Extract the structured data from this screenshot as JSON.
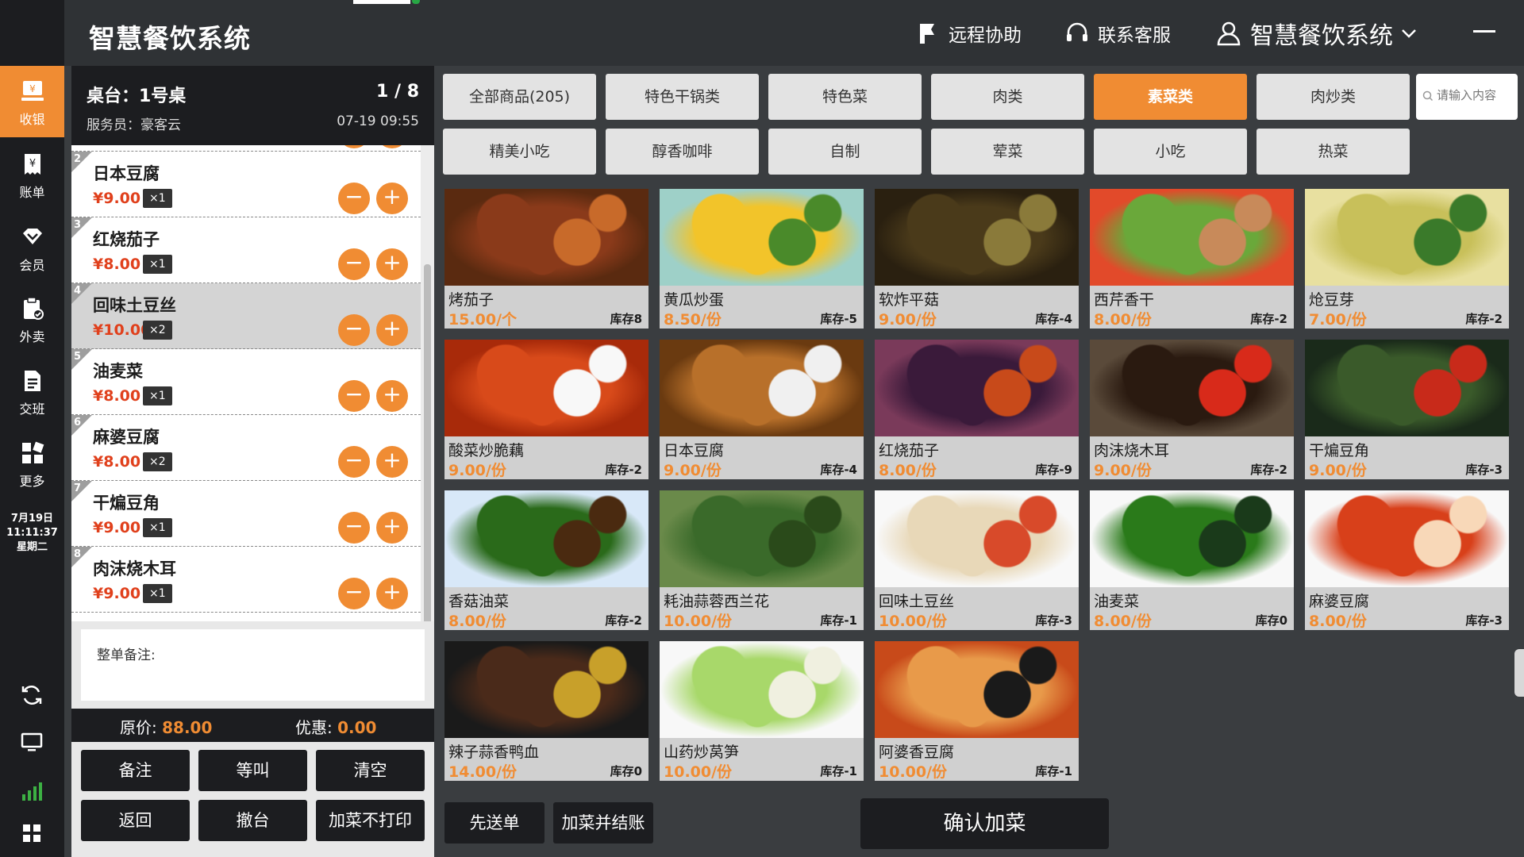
{
  "app_title": "智慧餐饮系统",
  "header": {
    "remote_assist": "远程协助",
    "contact_service": "联系客服",
    "user_menu": "智慧餐饮系统"
  },
  "nav": {
    "items": [
      {
        "label": "收银",
        "icon": "cashier-icon",
        "active": true
      },
      {
        "label": "账单",
        "icon": "bill-icon",
        "active": false
      },
      {
        "label": "会员",
        "icon": "member-icon",
        "active": false
      },
      {
        "label": "外卖",
        "icon": "takeout-icon",
        "active": false
      },
      {
        "label": "交班",
        "icon": "shift-icon",
        "active": false
      },
      {
        "label": "更多",
        "icon": "more-icon",
        "active": false
      }
    ],
    "clock": {
      "date": "7月19日",
      "time": "11:11:37",
      "weekday": "星期二"
    }
  },
  "order": {
    "table": "桌台：1号桌",
    "waiter": "服务员：豪客云",
    "page": "1 / 8",
    "time": "07-19 09:55",
    "items": [
      {
        "index": "2",
        "name": "日本豆腐",
        "price": "¥9.00",
        "qty": "×1",
        "selected": false
      },
      {
        "index": "3",
        "name": "红烧茄子",
        "price": "¥8.00",
        "qty": "×1",
        "selected": false
      },
      {
        "index": "4",
        "name": "回味土豆丝",
        "price": "¥10.00",
        "qty": "×2",
        "selected": true
      },
      {
        "index": "5",
        "name": "油麦菜",
        "price": "¥8.00",
        "qty": "×1",
        "selected": false
      },
      {
        "index": "6",
        "name": "麻婆豆腐",
        "price": "¥8.00",
        "qty": "×2",
        "selected": false
      },
      {
        "index": "7",
        "name": "干煸豆角",
        "price": "¥9.00",
        "qty": "×1",
        "selected": false
      },
      {
        "index": "8",
        "name": "肉沫烧木耳",
        "price": "¥9.00",
        "qty": "×1",
        "selected": false
      }
    ],
    "remark_label": "整单备注:",
    "original_price_label": "原价:",
    "original_price": "88.00",
    "discount_label": "优惠:",
    "discount": "0.00",
    "buttons": [
      "备注",
      "等叫",
      "清空",
      "返回",
      "撤台",
      "加菜不打印"
    ]
  },
  "categories": {
    "items": [
      {
        "label": "全部商品(205)",
        "active": false
      },
      {
        "label": "特色干锅类",
        "active": false
      },
      {
        "label": "特色菜",
        "active": false
      },
      {
        "label": "肉类",
        "active": false
      },
      {
        "label": "素菜类",
        "active": true
      },
      {
        "label": "肉炒类",
        "active": false
      },
      {
        "label": "精美小吃",
        "active": false
      },
      {
        "label": "醇香咖啡",
        "active": false
      },
      {
        "label": "自制",
        "active": false
      },
      {
        "label": "荤菜",
        "active": false
      },
      {
        "label": "小吃",
        "active": false
      },
      {
        "label": "热菜",
        "active": false
      }
    ],
    "search_placeholder": "请输入内容"
  },
  "dishes": [
    {
      "name": "烤茄子",
      "price": "15.00/个",
      "stock": "库存8",
      "colors": [
        "#8a3a1a",
        "#c86a2a",
        "#5a2a10"
      ]
    },
    {
      "name": "黄瓜炒蛋",
      "price": "8.50/份",
      "stock": "库存-5",
      "colors": [
        "#f2c42a",
        "#4a8a2a",
        "#9ed0c8"
      ]
    },
    {
      "name": "软炸平菇",
      "price": "9.00/份",
      "stock": "库存-4",
      "colors": [
        "#4a3a1a",
        "#8a7a3a",
        "#2a2010"
      ]
    },
    {
      "name": "西芹香干",
      "price": "8.00/份",
      "stock": "库存-2",
      "colors": [
        "#6aa83a",
        "#c88a5a",
        "#e24a2a"
      ]
    },
    {
      "name": "炝豆芽",
      "price": "7.00/份",
      "stock": "库存-2",
      "colors": [
        "#c8c05a",
        "#3a7a2a",
        "#e8e0a0"
      ]
    },
    {
      "name": "酸菜炒脆藕",
      "price": "9.00/份",
      "stock": "库存-2",
      "colors": [
        "#d84a1a",
        "#f8f8f8",
        "#a82a0a"
      ]
    },
    {
      "name": "日本豆腐",
      "price": "9.00/份",
      "stock": "库存-4",
      "colors": [
        "#b8702a",
        "#f0f0f0",
        "#6a3a10"
      ]
    },
    {
      "name": "红烧茄子",
      "price": "8.00/份",
      "stock": "库存-9",
      "colors": [
        "#3a1a3a",
        "#c84a1a",
        "#7a3a5a"
      ]
    },
    {
      "name": "肉沫烧木耳",
      "price": "9.00/份",
      "stock": "库存-2",
      "colors": [
        "#2a1a10",
        "#d82a1a",
        "#5a4a3a"
      ]
    },
    {
      "name": "干煸豆角",
      "price": "9.00/份",
      "stock": "库存-3",
      "colors": [
        "#3a5a2a",
        "#c82a1a",
        "#1a2a1a"
      ]
    },
    {
      "name": "香菇油菜",
      "price": "8.00/份",
      "stock": "库存-2",
      "colors": [
        "#2a6a1a",
        "#4a2a10",
        "#d8e8f8"
      ]
    },
    {
      "name": "耗油蒜蓉西兰花",
      "price": "10.00/份",
      "stock": "库存-1",
      "colors": [
        "#3a6a2a",
        "#2a4a1a",
        "#6a8a4a"
      ]
    },
    {
      "name": "回味土豆丝",
      "price": "10.00/份",
      "stock": "库存-3",
      "colors": [
        "#e8d8b8",
        "#d84a2a",
        "#f8f8f8"
      ]
    },
    {
      "name": "油麦菜",
      "price": "8.00/份",
      "stock": "库存0",
      "colors": [
        "#2a7a1a",
        "#1a3a1a",
        "#f8f8f8"
      ]
    },
    {
      "name": "麻婆豆腐",
      "price": "8.00/份",
      "stock": "库存-3",
      "colors": [
        "#d8401a",
        "#f8d8b8",
        "#f8f8f8"
      ]
    },
    {
      "name": "辣子蒜香鸭血",
      "price": "14.00/份",
      "stock": "库存0",
      "colors": [
        "#4a2a1a",
        "#c8a02a",
        "#1a1a1a"
      ]
    },
    {
      "name": "山药炒莴笋",
      "price": "10.00/份",
      "stock": "库存-1",
      "colors": [
        "#a8d86a",
        "#f0f0e0",
        "#f8f8f8"
      ]
    },
    {
      "name": "阿婆香豆腐",
      "price": "10.00/份",
      "stock": "库存-1",
      "colors": [
        "#e89a4a",
        "#1a1a1a",
        "#c84a1a"
      ]
    }
  ],
  "bottom": {
    "send_first": "先送单",
    "add_and_checkout": "加菜并结账",
    "confirm_add": "确认加菜"
  }
}
